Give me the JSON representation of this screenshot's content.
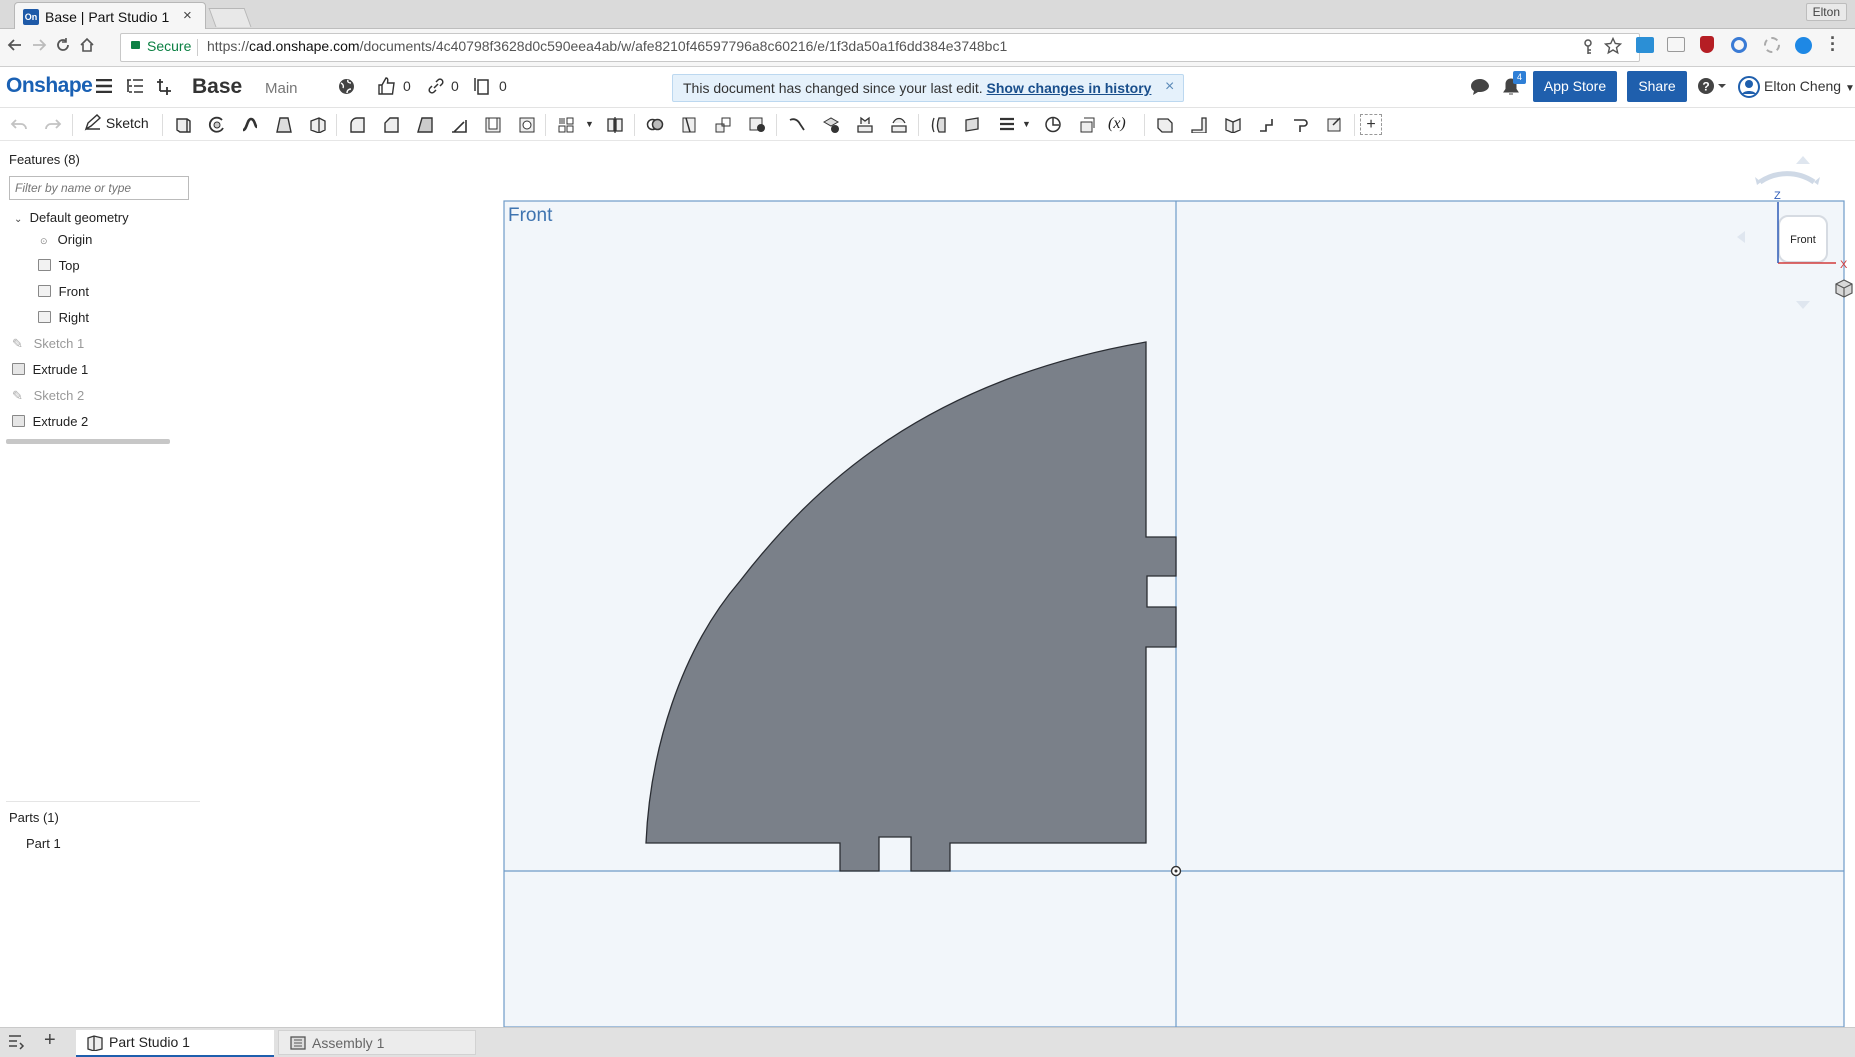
{
  "browser": {
    "tab_title": "Base | Part Studio 1",
    "tab_favicon": "On",
    "tab_close": "×",
    "profile": "Elton",
    "secure_label": "Secure",
    "url_scheme": "https://",
    "url_host": "cad.onshape.com",
    "url_path": "/documents/4c40798f3628d0c590eea4ab/w/afe8210f46597796a8c60216/e/1f3da50a1f6dd384e3748bc1"
  },
  "app": {
    "logo": "Onshape",
    "document_name": "Base",
    "workspace": "Main",
    "likes": "0",
    "links": "0",
    "copies": "0",
    "banner_text": "This document has changed since your last edit.",
    "banner_link": "Show changes in history",
    "banner_close": "×",
    "notification_count": "4",
    "app_store": "App Store",
    "share": "Share",
    "user": "Elton Cheng"
  },
  "toolbar": {
    "sketch_label": "Sketch",
    "variable_label": "(x)"
  },
  "features": {
    "header": "Features (8)",
    "filter_placeholder": "Filter by name or type",
    "default_geometry": "Default geometry",
    "planes": [
      "Origin",
      "Top",
      "Front",
      "Right"
    ],
    "items": [
      {
        "label": "Sketch 1",
        "type": "sketch"
      },
      {
        "label": "Extrude 1",
        "type": "extrude"
      },
      {
        "label": "Sketch 2",
        "type": "sketch"
      },
      {
        "label": "Extrude 2",
        "type": "extrude"
      }
    ]
  },
  "parts": {
    "header": "Parts (1)",
    "items": [
      "Part 1"
    ]
  },
  "viewport": {
    "plane_label": "Front",
    "view_cube_label": "Front",
    "axis_z": "Z",
    "axis_x": "X",
    "part_color": "#7a8089",
    "plane_color": "#f2f6fa",
    "plane_border": "#6f9bc8"
  },
  "bottom_tabs": [
    "Part Studio 1",
    "Assembly 1"
  ],
  "colors": {
    "brand": "#1a61b4",
    "button": "#1f5fad",
    "banner_bg": "#e5f1fb"
  }
}
